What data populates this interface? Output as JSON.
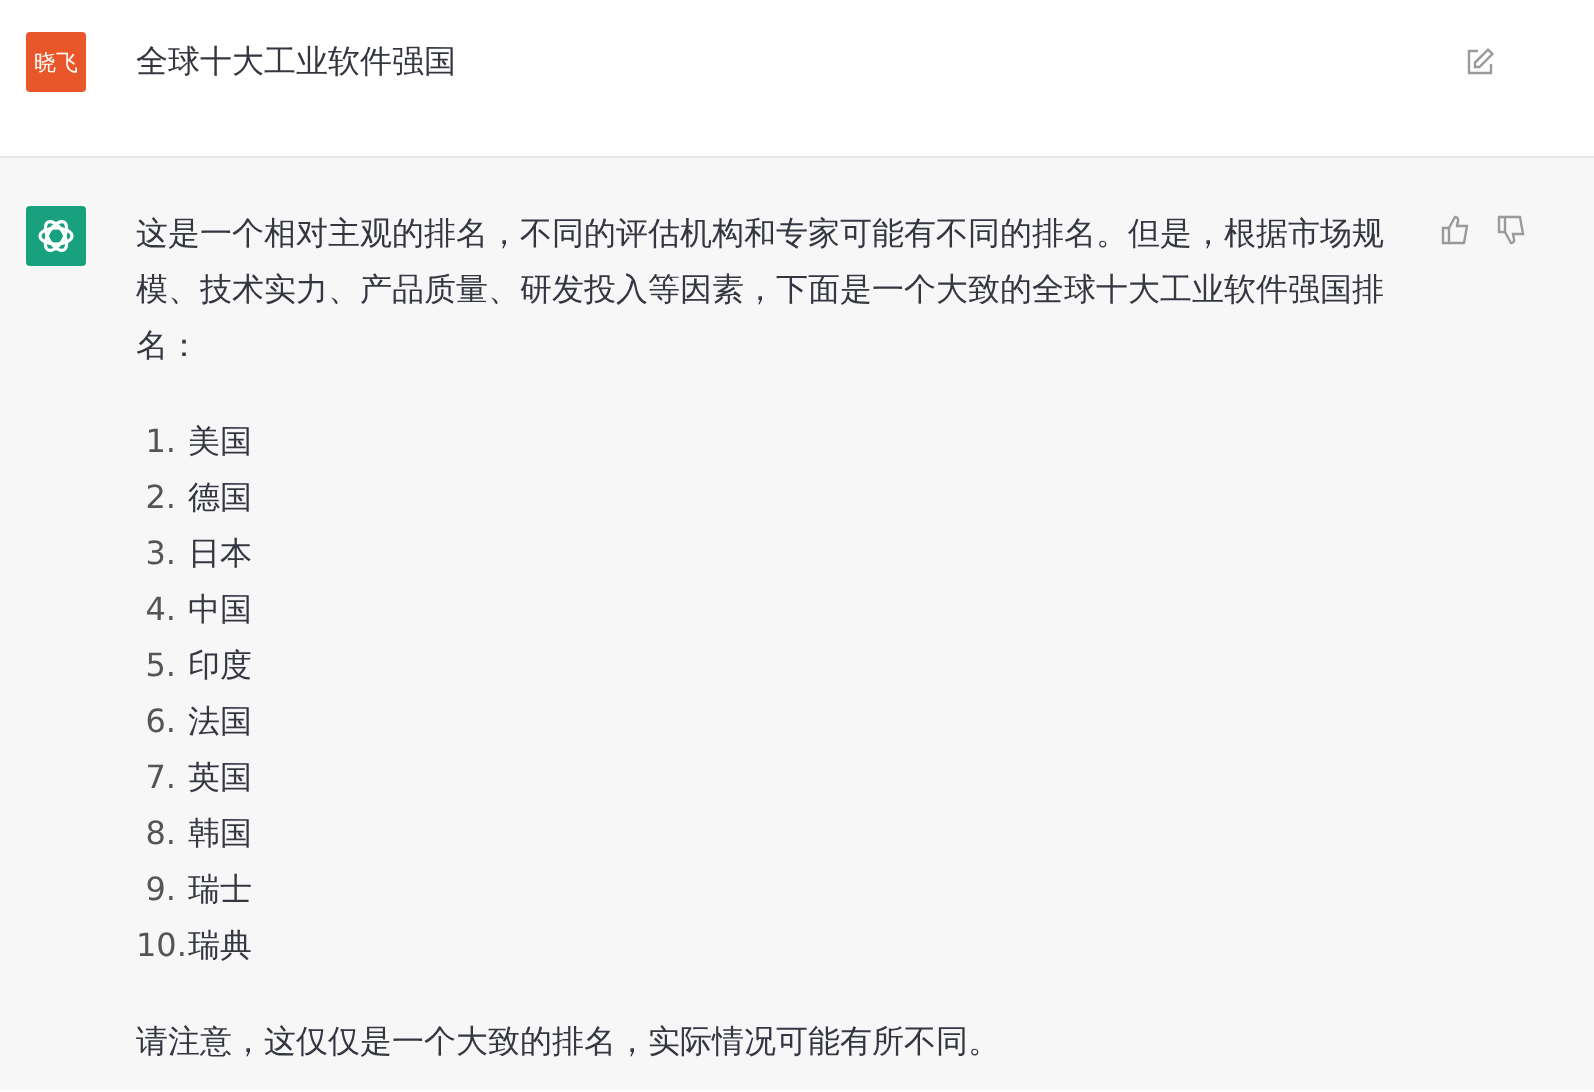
{
  "user_message": {
    "avatar_text": "晓飞",
    "text": "全球十大工业软件强国"
  },
  "reply": {
    "intro": "这是一个相对主观的排名，不同的评估机构和专家可能有不同的排名。但是，根据市场规模、技术实力、产品质量、研发投入等因素，下面是一个大致的全球十大工业软件强国排名：",
    "ranking": [
      {
        "number": "1.",
        "country": "美国"
      },
      {
        "number": "2.",
        "country": "德国"
      },
      {
        "number": "3.",
        "country": "日本"
      },
      {
        "number": "4.",
        "country": "中国"
      },
      {
        "number": "5.",
        "country": "印度"
      },
      {
        "number": "6.",
        "country": "法国"
      },
      {
        "number": "7.",
        "country": "英国"
      },
      {
        "number": "8.",
        "country": "韩国"
      },
      {
        "number": "9.",
        "country": "瑞士"
      },
      {
        "number": "10.",
        "country": "瑞典"
      }
    ],
    "note": "请注意，这仅仅是一个大致的排名，实际情况可能有所不同。"
  }
}
